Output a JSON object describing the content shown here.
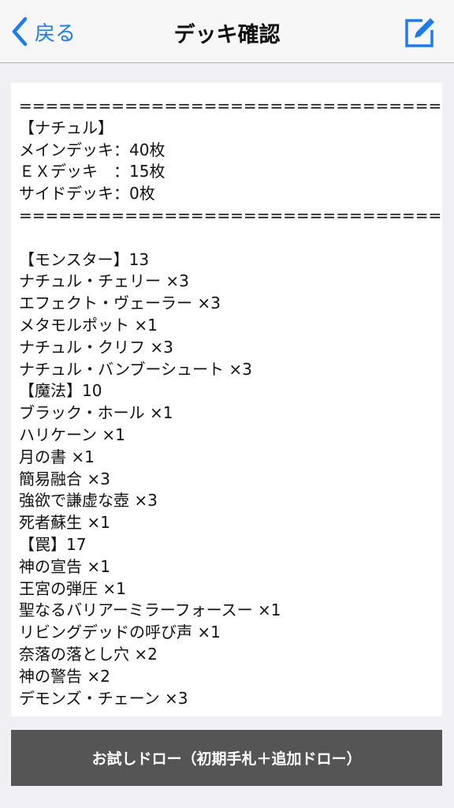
{
  "navbar": {
    "back_label": "戻る",
    "title": "デッキ確認"
  },
  "deck_text": "==================================\n【ナチュル】\nメインデッキ：40枚\nＥＸデッキ　：15枚\nサイドデッキ：0枚\n==================================\n\n【モンスター】13\nナチュル・チェリー ×3\nエフェクト・ヴェーラー ×3\nメタモルポット ×1\nナチュル・クリフ ×3\nナチュル・バンブーシュート ×3\n【魔法】10\nブラック・ホール ×1\nハリケーン ×1\n月の書 ×1\n簡易融合 ×3\n強欲で謙虚な壺 ×3\n死者蘇生 ×1\n【罠】17\n神の宣告 ×1\n王宮の弾圧 ×1\n聖なるバリアーミラーフォースー ×1\nリビングデッドの呼び声 ×1\n奈落の落とし穴 ×2\n神の警告 ×2\nデモンズ・チェーン ×3",
  "draw_button_label": "お試しドロー（初期手札＋追加ドロー）",
  "colors": {
    "accent": "#1a7cf5",
    "button_bg": "#555555",
    "background": "#efeff4"
  }
}
